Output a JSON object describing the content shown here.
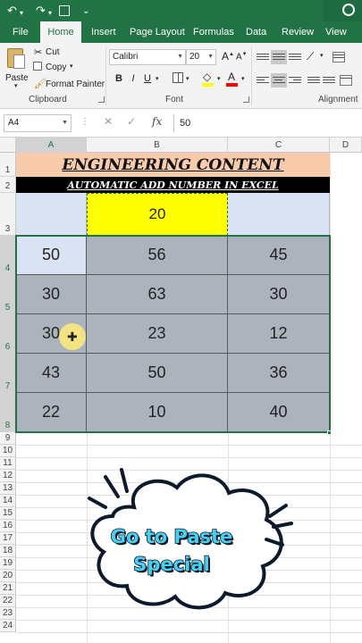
{
  "quick_access": {
    "undo": "↶",
    "redo": "↷",
    "save": "🖫",
    "customize": "⌄"
  },
  "ribbon_tabs": [
    "File",
    "Home",
    "Insert",
    "Page Layout",
    "Formulas",
    "Data",
    "Review",
    "View"
  ],
  "active_tab": "Home",
  "clipboard": {
    "paste_label": "Paste",
    "cut_label": "Cut",
    "copy_label": "Copy",
    "format_painter_label": "Format Painter",
    "group_label": "Clipboard"
  },
  "font": {
    "name": "Calibri",
    "size": "20",
    "bold": "B",
    "italic": "I",
    "underline": "U",
    "group_label": "Font",
    "font_color": "#ff0000",
    "fill_color": "#ffff00"
  },
  "alignment": {
    "group_label": "Alignment"
  },
  "formula_bar": {
    "name_box": "A4",
    "fx_label": "fx",
    "value": "50",
    "cancel": "✕",
    "enter": "✓"
  },
  "columns": [
    "A",
    "B",
    "C",
    "D"
  ],
  "selected_column": "A",
  "rows": [
    "1",
    "2",
    "3",
    "4",
    "5",
    "6",
    "7",
    "8",
    "9",
    "10",
    "11",
    "12",
    "13",
    "14",
    "15",
    "16",
    "17",
    "18",
    "19",
    "20",
    "21",
    "22",
    "23",
    "24"
  ],
  "sheet": {
    "title": "ENGINEERING CONTENT",
    "subtitle": "AUTOMATIC ADD NUMBER  IN EXCEL",
    "copied_value": "20",
    "data": [
      [
        "50",
        "56",
        "45"
      ],
      [
        "30",
        "63",
        "30"
      ],
      [
        "30",
        "23",
        "12"
      ],
      [
        "43",
        "50",
        "36"
      ],
      [
        "22",
        "10",
        "40"
      ]
    ]
  },
  "callout": {
    "line1": "Go to Paste",
    "line2": "Special"
  },
  "colors": {
    "excel_green": "#217346",
    "title_fill": "#f8cbad",
    "header_fill": "#dae3f3",
    "data_fill": "#acb3bd",
    "highlight": "#ffff00",
    "callout_text": "#4ad0ef"
  }
}
